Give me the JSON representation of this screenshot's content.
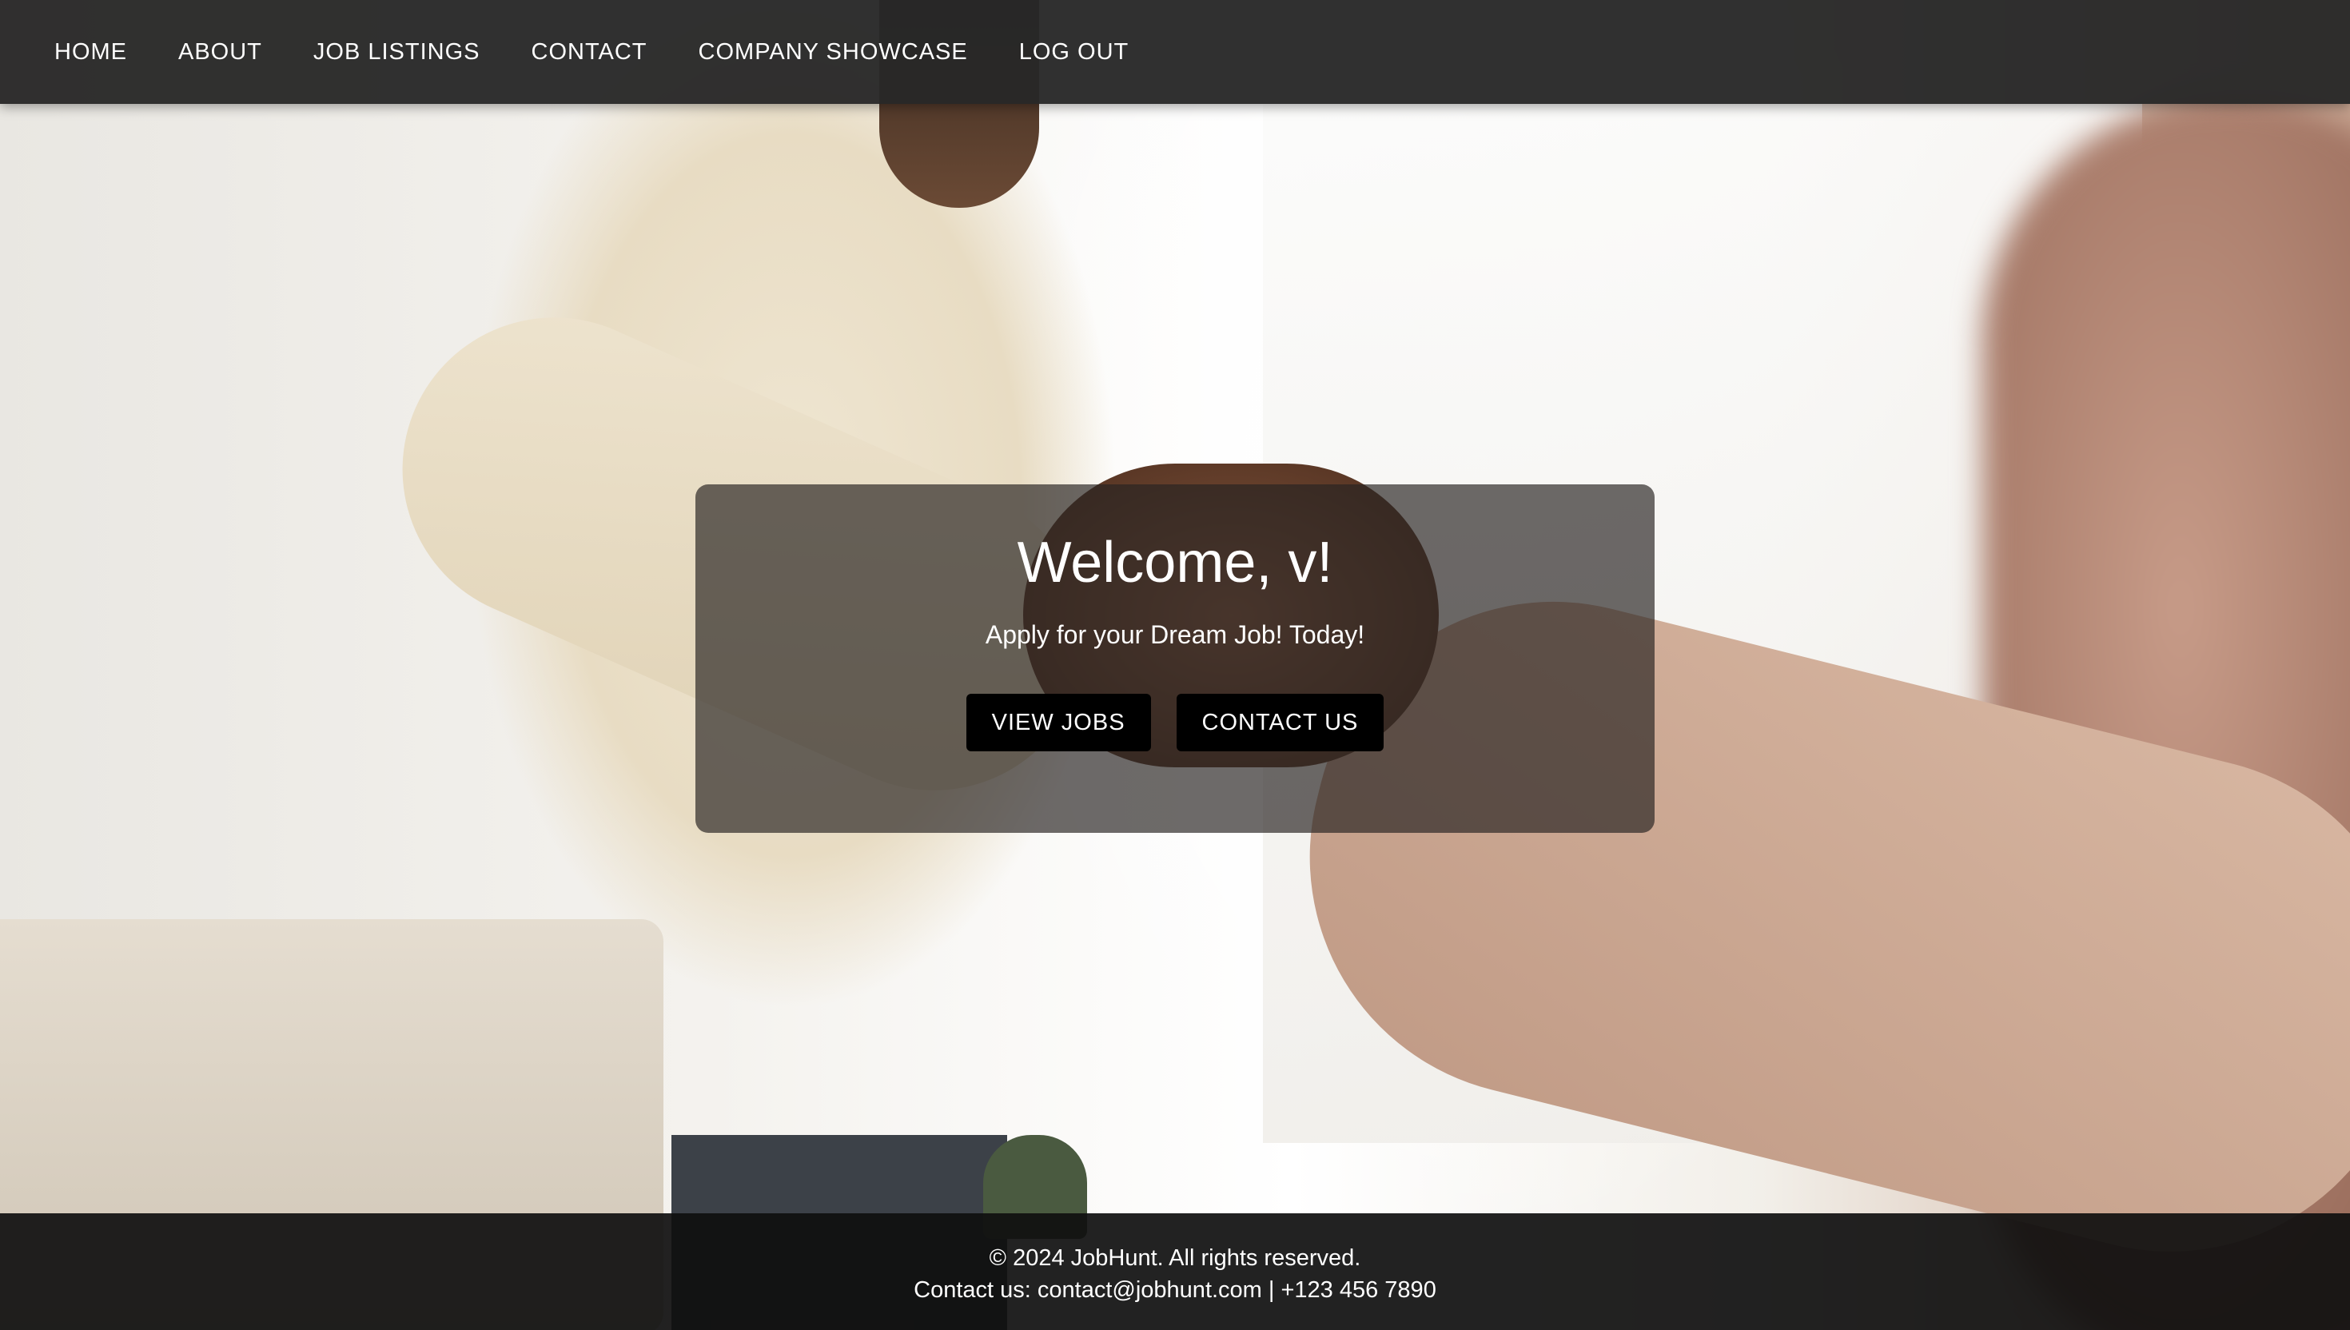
{
  "nav": {
    "items": [
      {
        "label": "HOME"
      },
      {
        "label": "ABOUT"
      },
      {
        "label": "JOB LISTINGS"
      },
      {
        "label": "CONTACT"
      },
      {
        "label": "COMPANY SHOWCASE"
      },
      {
        "label": "LOG OUT"
      }
    ]
  },
  "hero": {
    "title": "Welcome, v!",
    "subtitle": "Apply for your Dream Job! Today!",
    "buttons": {
      "view_jobs": "VIEW JOBS",
      "contact_us": "CONTACT US"
    }
  },
  "footer": {
    "copyright": "© 2024 JobHunt. All rights reserved.",
    "contact": "Contact us: contact@jobhunt.com | +123 456 7890"
  },
  "colors": {
    "navbar_bg": "#282828",
    "card_bg": "#282422",
    "button_bg": "#000000",
    "footer_bg": "#0f0f0f",
    "text": "#ffffff"
  }
}
